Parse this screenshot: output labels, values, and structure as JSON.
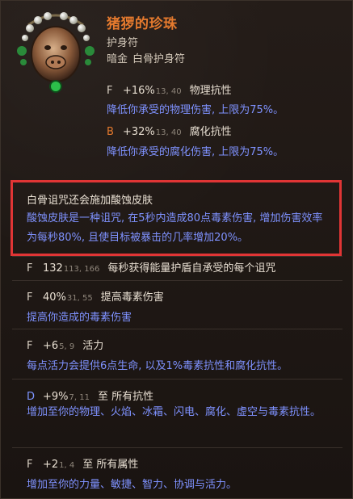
{
  "item": {
    "title": "猪猡的珍珠",
    "subtitle": "护身符",
    "tags": [
      "暗金",
      "白骨护身符"
    ],
    "icon": "amulet-icon"
  },
  "props": [
    {
      "lead": "F",
      "value": "+16%",
      "range": "13, 40",
      "name": "物理抗性",
      "desc": "降低你承受的物理伤害, 上限为75%。"
    },
    {
      "lead": "B",
      "value": "+32%",
      "range": "13, 40",
      "name": "腐化抗性",
      "desc": "降低你承受的腐化伤害, 上限为75%。"
    }
  ],
  "highlight": {
    "title": "白骨诅咒还会施加酸蚀皮肤",
    "desc": "酸蚀皮肤是一种诅咒, 在5秒内造成80点毒素伤害, 增加伤害效率为每秒80%, 且使目标被暴击的几率增加20%。"
  },
  "mods": [
    {
      "lead": "F",
      "value": "132",
      "range": "113, 166",
      "name": "每秒获得能量护盾自承受的每个诅咒",
      "desc": ""
    },
    {
      "lead": "F",
      "value": "40%",
      "range": "31, 55",
      "name": "提高毒素伤害",
      "desc": "提高你造成的毒素伤害"
    },
    {
      "lead": "F",
      "value": "+6",
      "range": "5, 9",
      "name": "活力",
      "desc": "每点活力会提供6点生命, 以及1%毒素抗性和腐化抗性。"
    },
    {
      "lead": "D",
      "value": "+9%",
      "range": "7, 11",
      "name": "至 所有抗性",
      "desc": "增加至你的物理、火焰、冰霜、闪电、腐化、虚空与毒素抗性。"
    },
    {
      "lead": "F",
      "value": "+2",
      "range": "1, 4",
      "name": "至 所有属性",
      "desc": "增加至你的力量、敏捷、智力、协调与活力。"
    }
  ],
  "colors": {
    "title": "#e57a2e",
    "desc": "#7f92ff",
    "highlight_border": "#e03535"
  }
}
